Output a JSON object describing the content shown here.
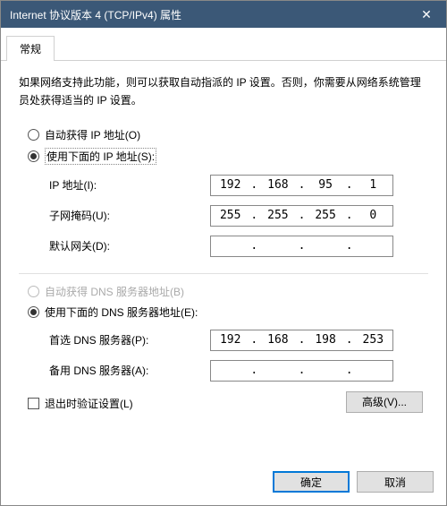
{
  "title": "Internet 协议版本 4 (TCP/IPv4) 属性",
  "tab_general": "常规",
  "description": "如果网络支持此功能，则可以获取自动指派的 IP 设置。否则，你需要从网络系统管理员处获得适当的 IP 设置。",
  "ip": {
    "auto_label": "自动获得 IP 地址(O)",
    "manual_label": "使用下面的 IP 地址(S):",
    "address_label": "IP 地址(I):",
    "mask_label": "子网掩码(U):",
    "gateway_label": "默认网关(D):",
    "address": {
      "o1": "192",
      "o2": "168",
      "o3": "95",
      "o4": "1"
    },
    "mask": {
      "o1": "255",
      "o2": "255",
      "o3": "255",
      "o4": "0"
    },
    "gateway": {
      "o1": "",
      "o2": "",
      "o3": "",
      "o4": ""
    }
  },
  "dns": {
    "auto_label": "自动获得 DNS 服务器地址(B)",
    "manual_label": "使用下面的 DNS 服务器地址(E):",
    "preferred_label": "首选 DNS 服务器(P):",
    "alternate_label": "备用 DNS 服务器(A):",
    "preferred": {
      "o1": "192",
      "o2": "168",
      "o3": "198",
      "o4": "253"
    },
    "alternate": {
      "o1": "",
      "o2": "",
      "o3": "",
      "o4": ""
    }
  },
  "validate_label": "退出时验证设置(L)",
  "advanced_label": "高级(V)...",
  "ok_label": "确定",
  "cancel_label": "取消"
}
